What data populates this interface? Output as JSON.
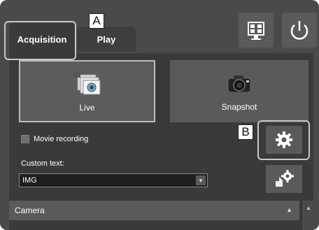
{
  "tabs": [
    {
      "label": "Acquisition",
      "active": true
    },
    {
      "label": "Play",
      "active": false
    }
  ],
  "buttons": {
    "live_label": "Live",
    "snapshot_label": "Snapshot"
  },
  "icons": {
    "monitor": "monitor-layout-icon",
    "power": "power-icon",
    "live": "live-camera-icon",
    "snapshot": "snapshot-camera-icon",
    "settings": "gear-icon",
    "export": "export-settings-icon"
  },
  "movie_recording": {
    "label": "Movie recording",
    "checked": false
  },
  "custom_text": {
    "label": "Custom text:",
    "value": "IMG"
  },
  "camera_section": {
    "label": "Camera"
  },
  "callouts": {
    "a": "A",
    "b": "B"
  },
  "colors": {
    "panel": "#4a4a4a",
    "content": "#3a3a3a",
    "button": "#5a5a5a",
    "highlight": "#c8c8c8"
  }
}
